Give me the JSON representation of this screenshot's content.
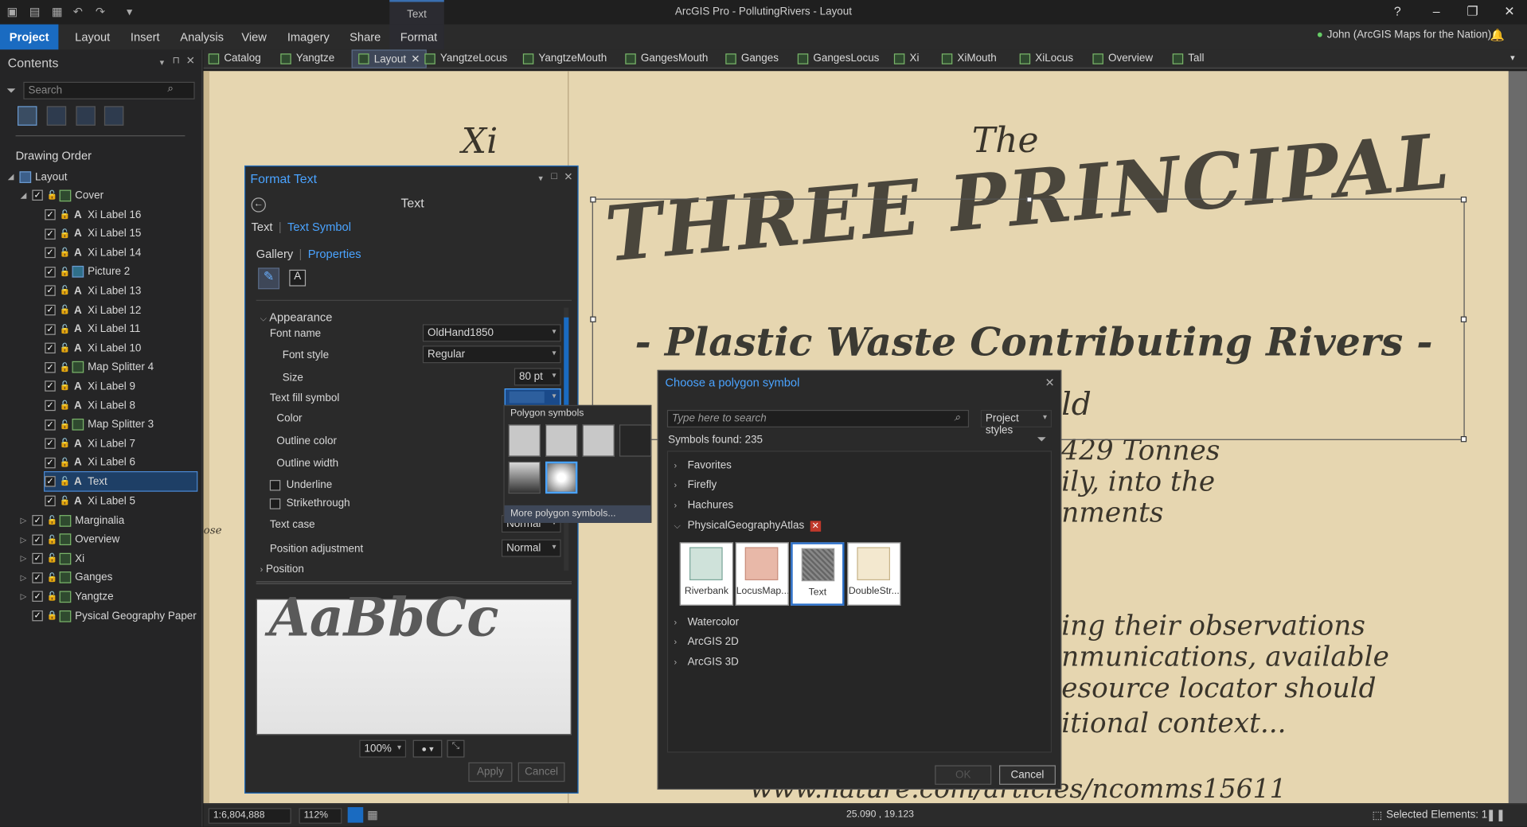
{
  "window": {
    "title": "ArcGIS Pro - PollutingRivers - Layout",
    "context_tab": "Text",
    "help": "?"
  },
  "ribbon": {
    "tabs": [
      "Project",
      "Layout",
      "Insert",
      "Analysis",
      "View",
      "Imagery",
      "Share",
      "Format"
    ],
    "user": "John (ArcGIS Maps for the Nation)"
  },
  "doc_tabs": [
    "Catalog",
    "Yangtze",
    "Layout",
    "YangtzeLocus",
    "YangtzeMouth",
    "GangesMouth",
    "Ganges",
    "GangesLocus",
    "Xi",
    "XiMouth",
    "XiLocus",
    "Overview",
    "Tall"
  ],
  "contents": {
    "title": "Contents",
    "search_placeholder": "Search",
    "drawing_order": "Drawing Order",
    "root": "Layout",
    "cover": "Cover",
    "cover_items": [
      "Xi Label 16",
      "Xi Label 15",
      "Xi Label 14",
      "Picture 2",
      "Xi Label 13",
      "Xi Label 12",
      "Xi Label 11",
      "Xi Label 10",
      "Map Splitter 4",
      "Xi Label 9",
      "Xi Label 8",
      "Map Splitter 3",
      "Xi Label 7",
      "Xi Label 6",
      "Text",
      "Xi Label 5"
    ],
    "cover_item_types": [
      "text",
      "text",
      "text",
      "picture",
      "text",
      "text",
      "text",
      "text",
      "map",
      "text",
      "text",
      "map",
      "text",
      "text",
      "text",
      "text"
    ],
    "top_items": [
      "Marginalia",
      "Overview",
      "Xi",
      "Ganges",
      "Yangtze",
      "Pysical Geography Paper"
    ]
  },
  "map": {
    "xi": "Xi",
    "the": "The",
    "three_principal": "THREE PRINCIPAL",
    "subtitle": "- Plastic Waste Contributing Rivers -",
    "frag_ld": "ld",
    "frag_tonnes": "429 Tonnes",
    "frag_into": "ily, into the",
    "frag_ments": "nments",
    "frag_ose": "ose",
    "frag_obs": "ing their observations",
    "frag_comm": "nmunications, available",
    "frag_res": "esource locator should",
    "frag_ctx": "itional context...",
    "frag_url": "www.nature.com/articles/ncomms15611"
  },
  "status": {
    "scale": "1:6,804,888",
    "zoom": "112%",
    "coords": "25.090 , 19.123",
    "selected": "Selected Elements: 1"
  },
  "format_text": {
    "title": "Format Text",
    "heading": "Text",
    "tab_text": "Text",
    "tab_symbol": "Text Symbol",
    "tab_gallery": "Gallery",
    "tab_properties": "Properties",
    "section": "Appearance",
    "font_name_label": "Font name",
    "font_name": "OldHand1850",
    "font_style_label": "Font style",
    "font_style": "Regular",
    "size_label": "Size",
    "size": "80 pt",
    "fill_label": "Text fill symbol",
    "color_label": "Color",
    "outline_color_label": "Outline color",
    "outline_width_label": "Outline width",
    "underline_label": "Underline",
    "strikethrough_label": "Strikethrough",
    "text_case_label": "Text case",
    "text_case": "Normal",
    "pos_adj_label": "Position adjustment",
    "pos_adj": "Normal",
    "position_section": "Position",
    "preview_text": "AaBbCc",
    "preview_zoom": "100%",
    "apply": "Apply",
    "cancel": "Cancel"
  },
  "polygon_popup": {
    "title": "Polygon symbols",
    "more": "More polygon symbols..."
  },
  "choose_symbol": {
    "title": "Choose a polygon symbol",
    "search_placeholder": "Type here to search",
    "styles": "Project styles",
    "found": "Symbols found: 235",
    "groups_before": [
      "Favorites",
      "Firefly",
      "Hachures"
    ],
    "expanded_group": "PhysicalGeographyAtlas",
    "symbols": [
      "Riverbank",
      "LocusMap...",
      "Text",
      "DoubleStr..."
    ],
    "groups_after": [
      "Watercolor",
      "ArcGIS 2D",
      "ArcGIS 3D"
    ],
    "ok": "OK",
    "cancel": "Cancel"
  }
}
